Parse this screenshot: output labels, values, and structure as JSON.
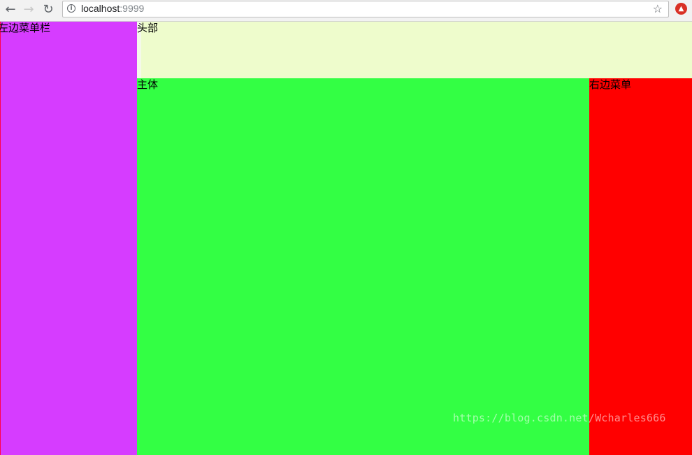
{
  "browser": {
    "url_host": "localhost",
    "url_port": ":9999",
    "icons": {
      "back": "back-arrow-icon",
      "forward": "forward-arrow-icon",
      "reload": "reload-icon",
      "info": "info-icon",
      "bookmark": "star-icon",
      "extension": "extension-icon"
    }
  },
  "page": {
    "left_menu_label": "左边菜单栏",
    "header_label": "头部",
    "main_label": "主体",
    "right_menu_label": "右边菜单",
    "colors": {
      "left_menu": "#d63cff",
      "header": "#eefccc",
      "main": "#33ff44",
      "right_menu": "#ff0000"
    }
  },
  "watermark": "https://blog.csdn.net/Wcharles666"
}
